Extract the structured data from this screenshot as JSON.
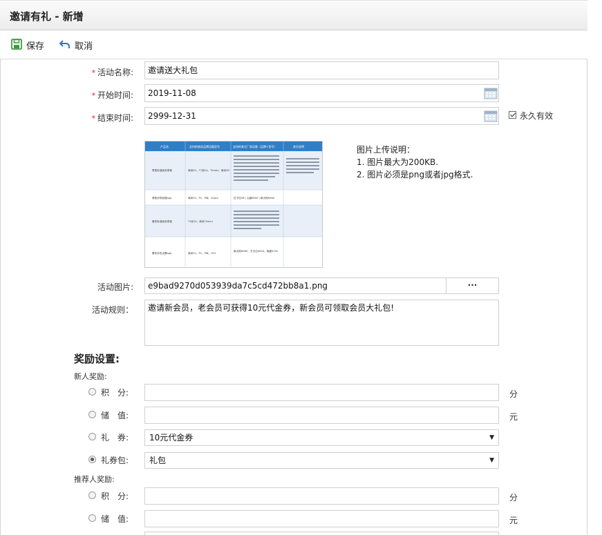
{
  "window": {
    "title": "邀请有礼 - 新增"
  },
  "toolbar": {
    "save_label": "保存",
    "cancel_label": "取消"
  },
  "form": {
    "activity_name": {
      "label": "活动名称:",
      "value": "邀请送大礼包"
    },
    "start_time": {
      "label": "开始时间:",
      "value": "2019-11-08"
    },
    "end_time": {
      "label": "结束时间:",
      "value": "2999-12-31"
    },
    "forever_label": "永久有效",
    "image_notes": {
      "title": "图片上传说明：",
      "line1": "1. 图片最大为200KB.",
      "line2": "2. 图片必须是png或者jpg格式."
    },
    "activity_image": {
      "label": "活动图片:",
      "value": "e9bad9270d053939da7c5cd472bb8a1.png",
      "browse_label": "···"
    },
    "activity_rules": {
      "label": "活动规则：",
      "value": "邀请新会员，老会员可获得10元代金券，新会员可领取会员大礼包!"
    }
  },
  "reward": {
    "title": "奖励设置:",
    "new_user": {
      "title": "新人奖励:",
      "points_label": "积　分:",
      "points_unit": "分",
      "stored_label": "储　值:",
      "stored_unit": "元",
      "coupon_label": "礼　券:",
      "coupon_value": "10元代金券",
      "package_label": "礼券包:",
      "package_value": "礼包"
    },
    "referrer": {
      "title": "推荐人奖励:",
      "points_label": "积　分:",
      "points_unit": "分",
      "stored_label": "储　值:",
      "stored_unit": "元"
    }
  },
  "thumbnail_table": {
    "headers": [
      "产品名",
      "支持的商米品牌设备型号",
      "支持的其它厂商设备（品牌+型号）",
      "其它说明"
    ],
    "rows": [
      [
        "零售标准版安卓端",
        "商米D1、T1双14、T2mini、商米D2",
        "石云X1、T1 \\ 宝盈M11、M102、M503、M102LA—拼屏 \\ 联想MKCR C31 \\ 捷宝7088A（12）\\ 百富S800 \\ 信达士IT5801 \\ 西溥K5-P2570 \\ 新联NewPOS \\ 创维Q-8 \\ 中科英泰CBF3208 \\ 信利T-8530",
        "后台登录管理端：APP需要单独在商米应用市场下载，其它厂商请到APP官网下载安装"
      ],
      [
        "零售手机收银app",
        "商米V1、P1、PIN、V2pro",
        "拉卡拉V8 \\ 九鼎8500 \\ 新大陆N900",
        ""
      ],
      [
        "餐饮标准版安卓端",
        "T1双14、商米T2mini",
        "平板（华为、荣耀）天宝、宝盈、新北洋、集成、佳博、易联、西溥、捷宝7088A \\ 捷宝7508A、中科英泰、大华A1、九鼎P800、百富S90、易捷C10",
        ""
      ],
      [
        "餐饮手机点餐app",
        "商米V1、P1、PIN、V1S",
        "新大陆N900、艾贝达A920、商盛S130",
        ""
      ]
    ]
  },
  "colors": {
    "accent_green": "#3e9a3e",
    "cancel_blue": "#3f6fb5",
    "required_red": "#e02020",
    "table_header": "#2f7fc8"
  }
}
